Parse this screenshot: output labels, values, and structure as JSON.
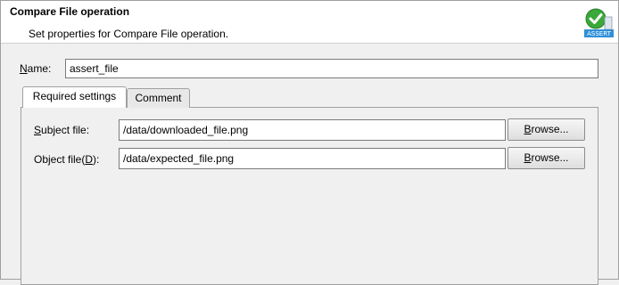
{
  "header": {
    "title": "Compare File operation",
    "description": "Set properties for Compare File operation.",
    "icon": "assert-check-icon",
    "icon_text": "ASSERT",
    "icon_color": "#3aa83a"
  },
  "name_field": {
    "label_mnemonic": "N",
    "label_rest": "ame:",
    "value": "assert_file"
  },
  "tabs": [
    {
      "label": "Required settings",
      "active": true
    },
    {
      "label": "Comment",
      "active": false
    }
  ],
  "subject_file": {
    "label_mnemonic": "S",
    "label_rest": "ubject file:",
    "value": "/data/downloaded_file.png",
    "browse": {
      "mnemonic": "B",
      "rest": "rowse..."
    }
  },
  "object_file": {
    "label_prefix": "Object file(",
    "label_mnemonic": "D",
    "label_suffix": "):",
    "value": "/data/expected_file.png",
    "browse": {
      "mnemonic": "B",
      "rest": "rowse..."
    }
  }
}
